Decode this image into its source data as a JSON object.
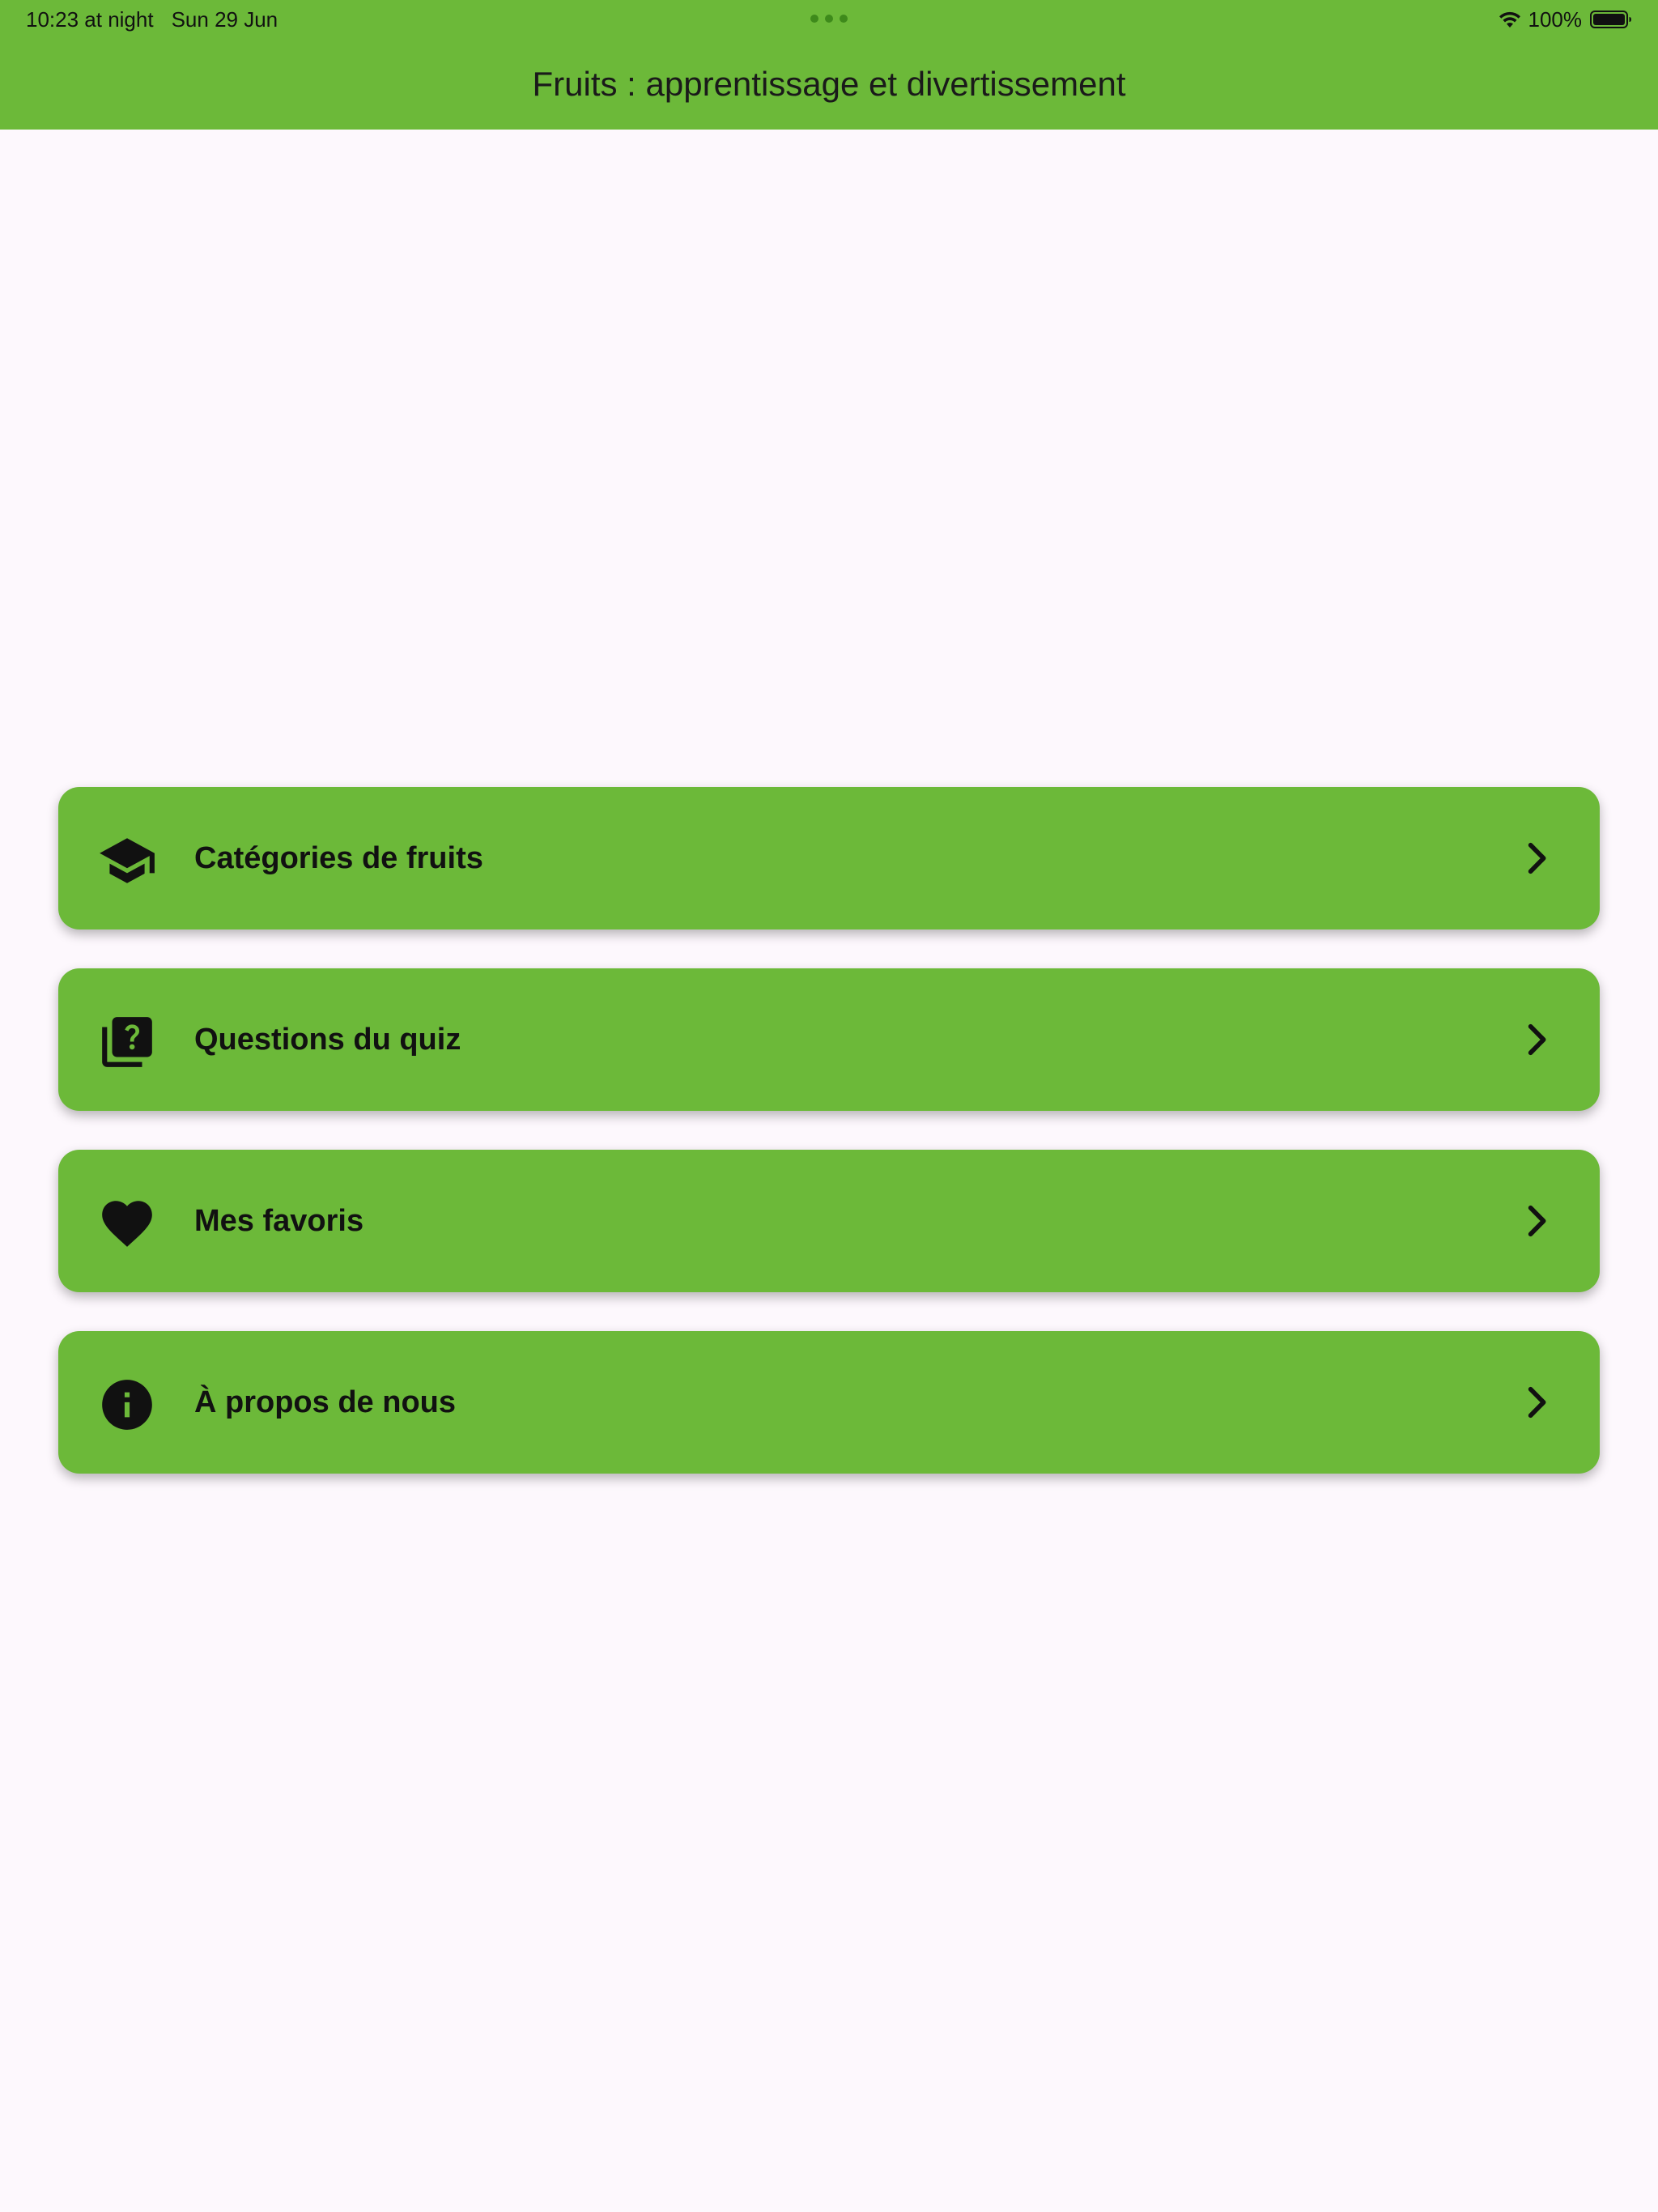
{
  "status_bar": {
    "time": "10:23 at night",
    "date": "Sun 29 Jun",
    "battery": "100%"
  },
  "app_bar": {
    "title": "Fruits : apprentissage et divertissement",
    "color": "#6cb939"
  },
  "menu": {
    "items": [
      {
        "label": "Catégories de fruits",
        "icon": "graduation-cap-icon"
      },
      {
        "label": "Questions du quiz",
        "icon": "quiz-icon"
      },
      {
        "label": "Mes favoris",
        "icon": "heart-icon"
      },
      {
        "label": "À propos de nous",
        "icon": "info-icon"
      }
    ]
  },
  "colors": {
    "accent": "#6cb939",
    "background": "#fdf8fd",
    "text": "#111111"
  }
}
